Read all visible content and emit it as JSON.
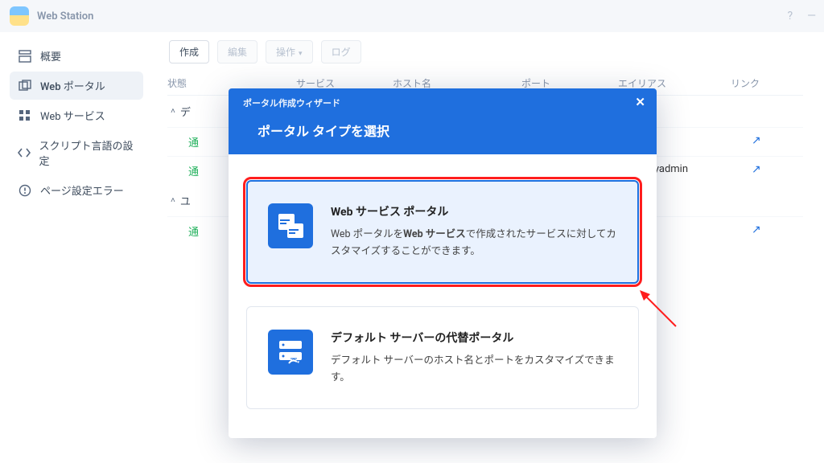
{
  "titlebar": {
    "title": "Web Station"
  },
  "sidebar": {
    "items": [
      {
        "label": "概要"
      },
      {
        "label": "Web ポータル"
      },
      {
        "label": "Web サービス"
      },
      {
        "label": "スクリプト言語の設定"
      },
      {
        "label": "ページ設定エラー"
      }
    ]
  },
  "toolbar": {
    "create": "作成",
    "edit": "編集",
    "action": "操作",
    "log": "ログ"
  },
  "table": {
    "headers": {
      "status": "状態",
      "service": "サービス",
      "host": "ホスト名",
      "port": "ポート",
      "alias": "エイリアス",
      "link": "リンク"
    },
    "groups": [
      {
        "label": "デ",
        "rows": [
          {
            "status": "通"
          }
        ]
      },
      {
        "label": "",
        "rows": [
          {
            "status": "通",
            "alias": "omyadmin"
          }
        ]
      },
      {
        "label": "ユ",
        "rows": [
          {
            "status": "通"
          }
        ]
      }
    ]
  },
  "modal": {
    "wizard_title": "ポータル作成ウィザード",
    "section_title": "ポータル タイプを選択",
    "options": [
      {
        "title": "Web サービス ポータル",
        "desc_pre": "Web ポータルを",
        "desc_bold": "Web サービス",
        "desc_post": "で作成されたサービスに対してカスタマイズすることができます。"
      },
      {
        "title": "デフォルト サーバーの代替ポータル",
        "desc_full": "デフォルト サーバーのホスト名とポートをカスタマイズできます。"
      }
    ]
  },
  "colors": {
    "primary": "#1f6fde",
    "highlight": "#ff1d1d",
    "status_ok": "#1fb05a"
  }
}
